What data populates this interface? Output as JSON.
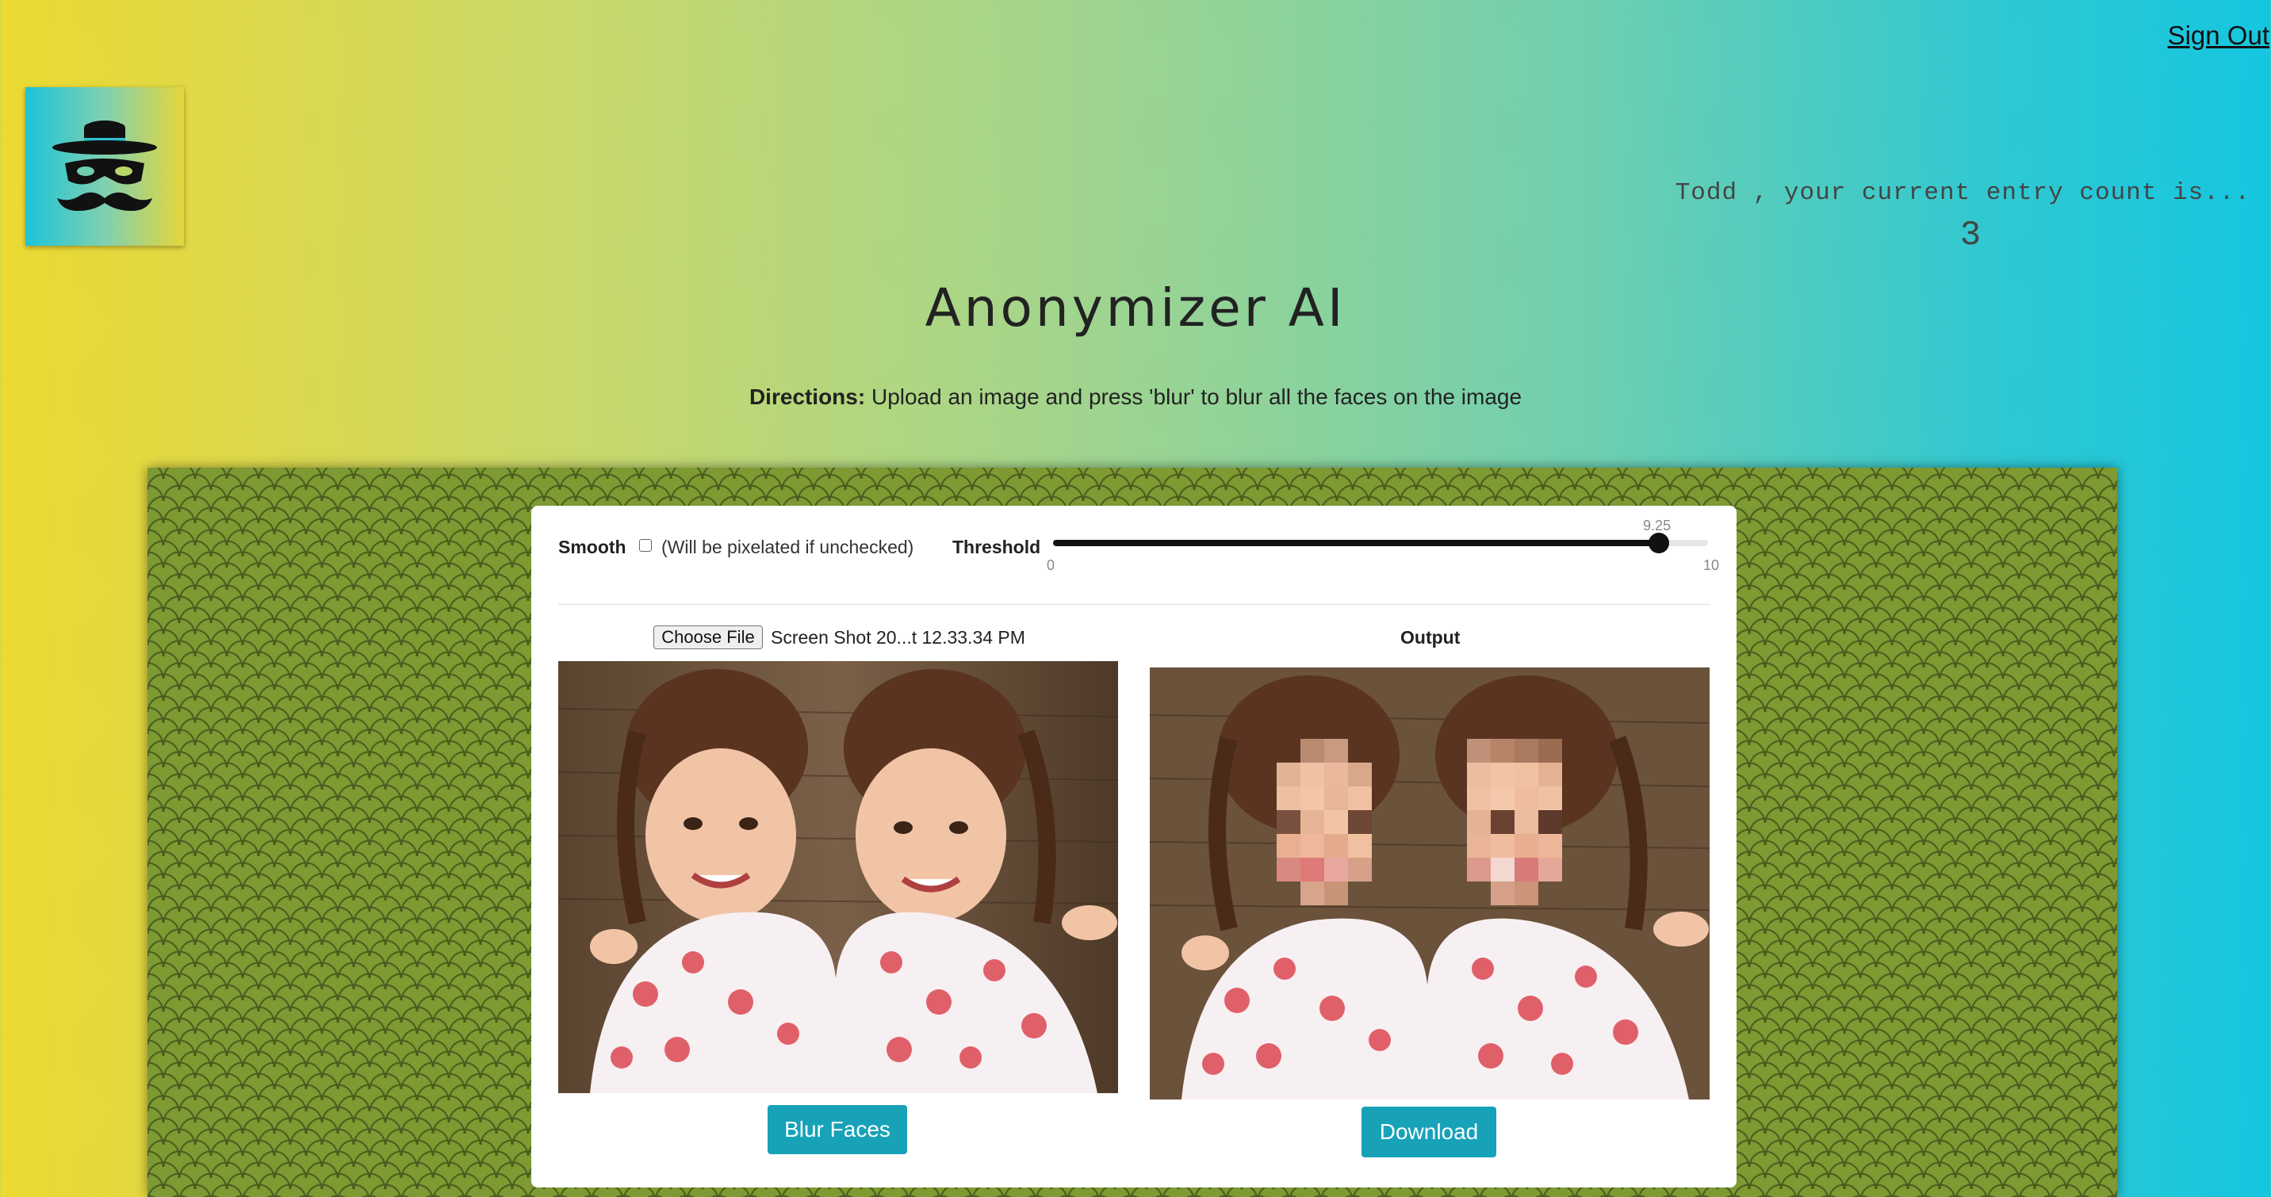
{
  "header": {
    "sign_out": "Sign Out",
    "entry_text": "Todd , your current entry count is...",
    "entry_count": "3",
    "logo_icon": "incognito-hat-mustache-icon"
  },
  "main": {
    "title": "Anonymizer AI",
    "directions_label": "Directions:",
    "directions_text": " Upload an image and press 'blur' to blur all the faces on the image"
  },
  "controls": {
    "smooth_label": "Smooth",
    "smooth_checked": false,
    "smooth_hint": "(Will be pixelated if unchecked)",
    "threshold_label": "Threshold",
    "threshold_value": 9.25,
    "threshold_value_label": "9.25",
    "threshold_min": 0,
    "threshold_min_label": "0",
    "threshold_max": 10,
    "threshold_max_label": "10"
  },
  "input": {
    "choose_file_label": "Choose File",
    "file_name": "Screen Shot 20...t 12.33.34 PM",
    "blur_button": "Blur Faces"
  },
  "output": {
    "label": "Output",
    "download_button": "Download"
  },
  "colors": {
    "button_teal": "#17a2b8",
    "frame_green": "#7d9a33"
  }
}
